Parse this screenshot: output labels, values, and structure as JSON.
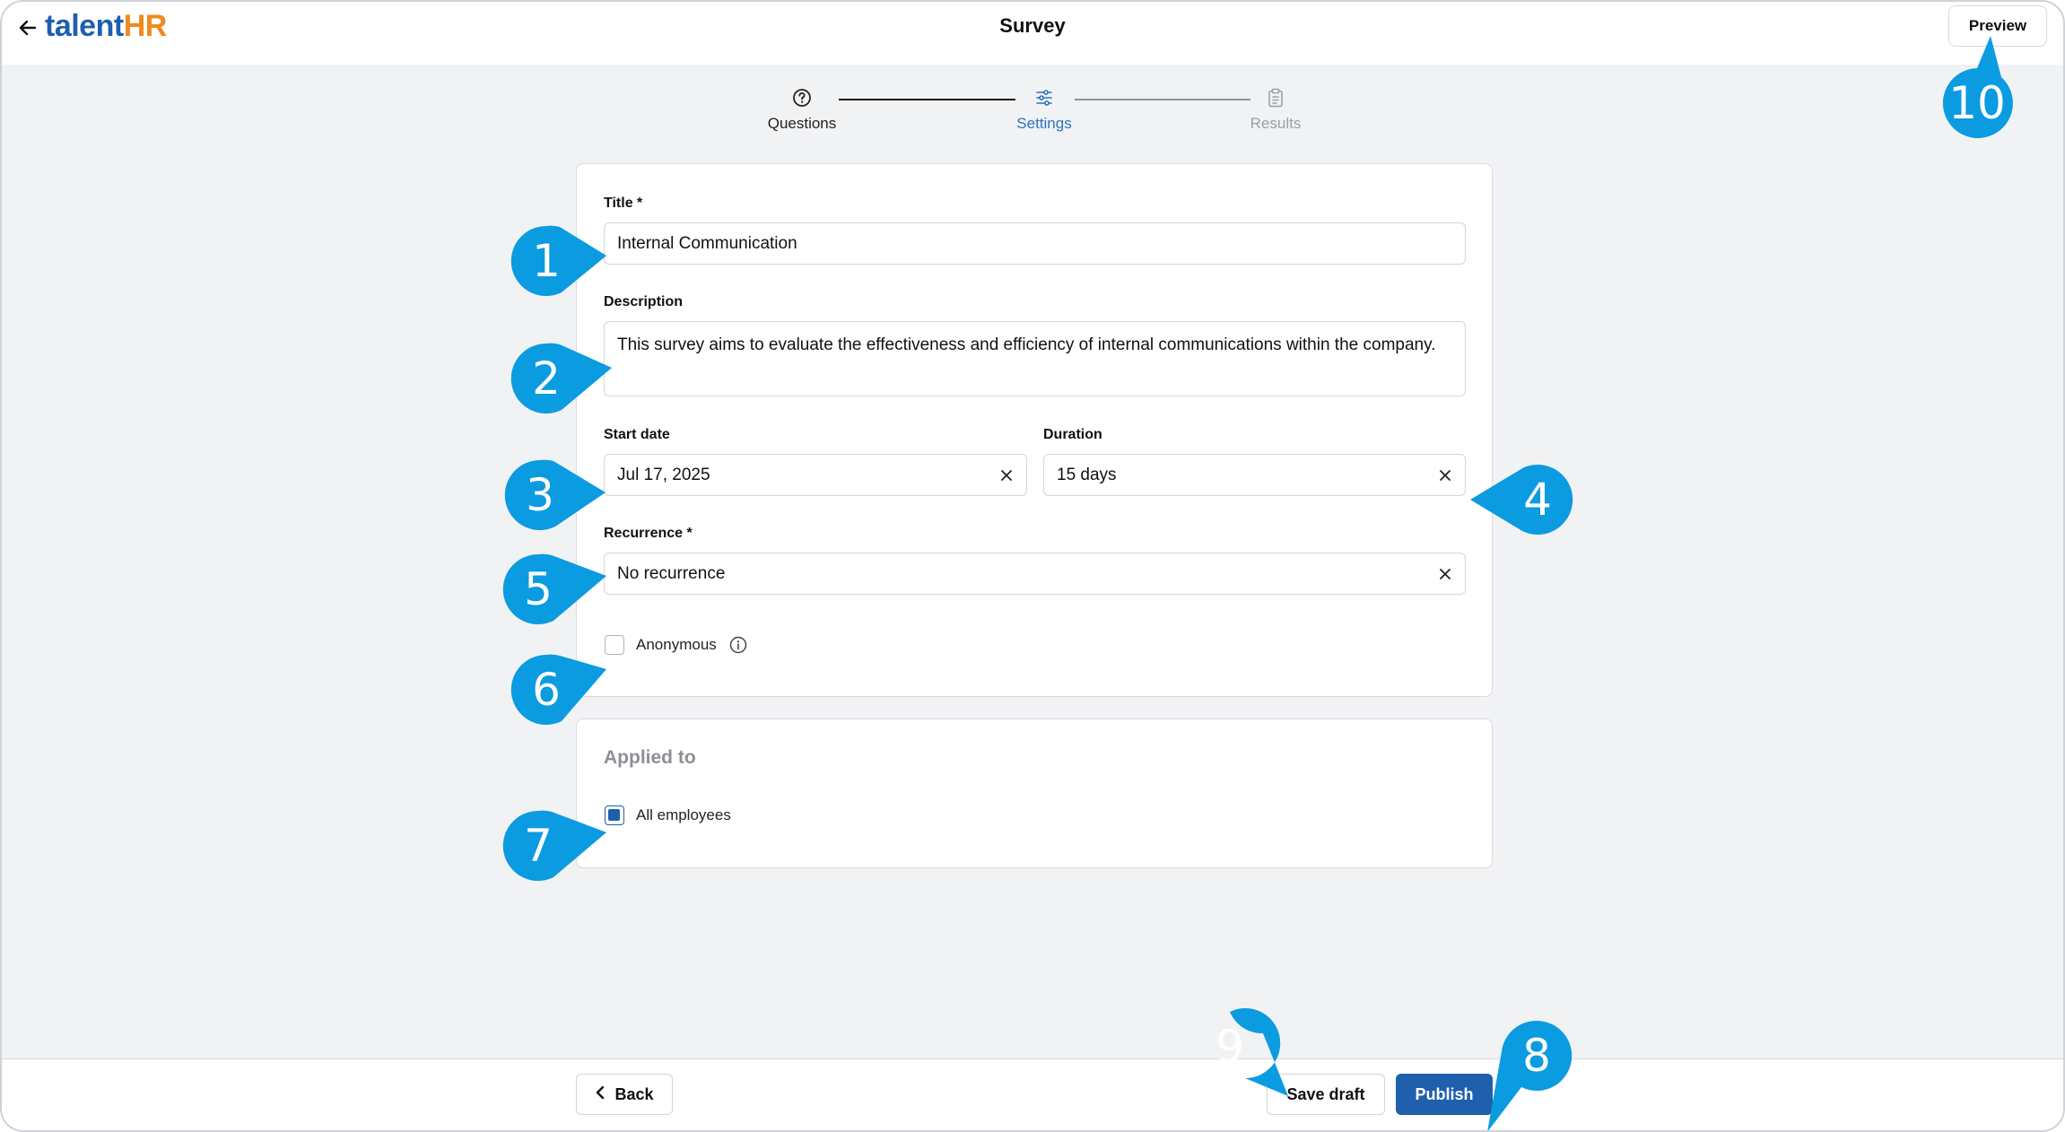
{
  "header": {
    "logo_part1": "talent",
    "logo_part2": "HR",
    "title": "Survey",
    "preview_label": "Preview"
  },
  "stepper": {
    "steps": [
      {
        "label": "Questions",
        "state": "completed"
      },
      {
        "label": "Settings",
        "state": "active"
      },
      {
        "label": "Results",
        "state": "pending"
      }
    ]
  },
  "form": {
    "title_label": "Title *",
    "title_value": "Internal Communication",
    "description_label": "Description",
    "description_value": "This survey aims to evaluate the effectiveness and efficiency of internal communications within the company.",
    "start_date_label": "Start date",
    "start_date_value": "Jul 17, 2025",
    "duration_label": "Duration",
    "duration_value": "15 days",
    "recurrence_label": "Recurrence *",
    "recurrence_value": "No recurrence",
    "anonymous_label": "Anonymous",
    "anonymous_checked": false
  },
  "applied": {
    "section_title": "Applied to",
    "all_employees_label": "All employees",
    "all_employees_checked": true
  },
  "footer": {
    "back_label": "Back",
    "save_draft_label": "Save draft",
    "publish_label": "Publish"
  },
  "callouts": [
    "1",
    "2",
    "3",
    "4",
    "5",
    "6",
    "7",
    "8",
    "9",
    "10"
  ],
  "colors": {
    "brand_blue": "#1f5fae",
    "brand_orange": "#f08a1c",
    "callout": "#0b9be0",
    "page_bg": "#f1f2f4"
  }
}
